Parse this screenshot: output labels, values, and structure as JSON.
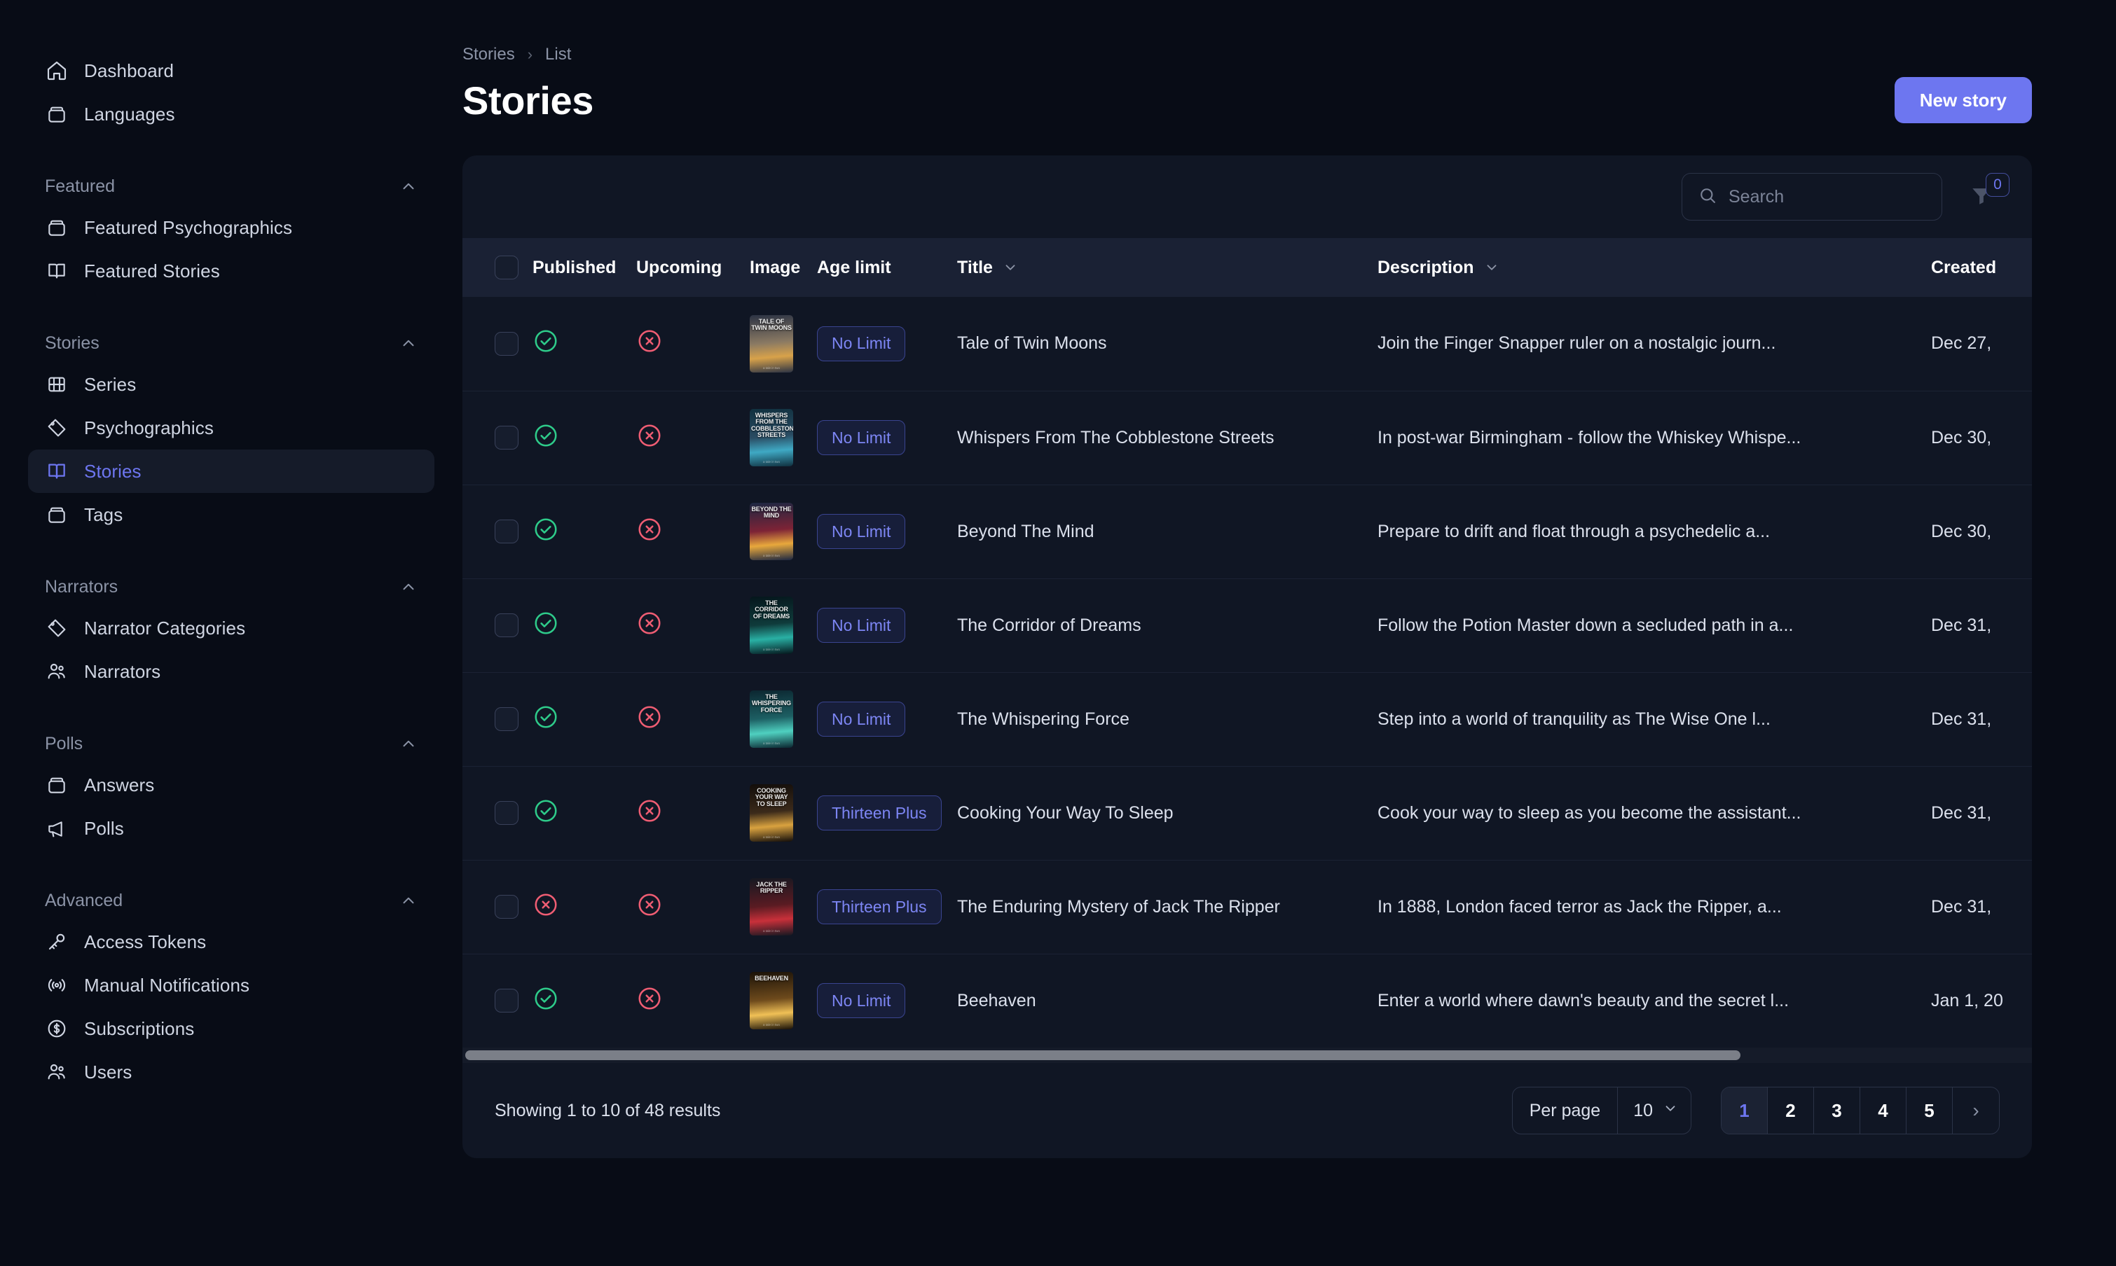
{
  "sidebar": {
    "top_items": [
      {
        "label": "Dashboard",
        "icon": "home-icon"
      },
      {
        "label": "Languages",
        "icon": "box-icon"
      }
    ],
    "groups": [
      {
        "label": "Featured",
        "items": [
          {
            "label": "Featured Psychographics",
            "icon": "box-icon"
          },
          {
            "label": "Featured Stories",
            "icon": "book-icon"
          }
        ]
      },
      {
        "label": "Stories",
        "items": [
          {
            "label": "Series",
            "icon": "film-icon"
          },
          {
            "label": "Psychographics",
            "icon": "tag-icon"
          },
          {
            "label": "Stories",
            "icon": "book-icon",
            "active": true
          },
          {
            "label": "Tags",
            "icon": "box-icon"
          }
        ]
      },
      {
        "label": "Narrators",
        "items": [
          {
            "label": "Narrator Categories",
            "icon": "tag-icon"
          },
          {
            "label": "Narrators",
            "icon": "users-icon"
          }
        ]
      },
      {
        "label": "Polls",
        "items": [
          {
            "label": "Answers",
            "icon": "box-icon"
          },
          {
            "label": "Polls",
            "icon": "megaphone-icon"
          }
        ]
      },
      {
        "label": "Advanced",
        "items": [
          {
            "label": "Access Tokens",
            "icon": "key-icon"
          },
          {
            "label": "Manual Notifications",
            "icon": "broadcast-icon"
          },
          {
            "label": "Subscriptions",
            "icon": "dollar-circle-icon"
          },
          {
            "label": "Users",
            "icon": "users-icon"
          }
        ]
      }
    ]
  },
  "header": {
    "breadcrumb": {
      "parent": "Stories",
      "separator": "›",
      "current": "List"
    },
    "title": "Stories",
    "new_button": "New story"
  },
  "toolbar": {
    "search_placeholder": "Search",
    "search_value": "",
    "filter_count": "0"
  },
  "table": {
    "columns": [
      {
        "key": "checkbox",
        "label": ""
      },
      {
        "key": "published",
        "label": "Published"
      },
      {
        "key": "upcoming",
        "label": "Upcoming"
      },
      {
        "key": "image",
        "label": "Image"
      },
      {
        "key": "age_limit",
        "label": "Age limit"
      },
      {
        "key": "title",
        "label": "Title",
        "sortable": true
      },
      {
        "key": "description",
        "label": "Description",
        "sortable": true
      },
      {
        "key": "created",
        "label": "Created"
      }
    ],
    "rows": [
      {
        "published": "yes",
        "upcoming": "no",
        "thumb_title": "Tale of Twin Moons",
        "thumb_footer": "a tale in two",
        "thumb_c1": "#8b7a63",
        "thumb_c2": "#2c3344",
        "thumb_c3": "#d8a24a",
        "age_limit": "No Limit",
        "title": "Tale of Twin Moons",
        "description": "Join the Finger Snapper ruler on a nostalgic journ...",
        "created": "Dec 27,"
      },
      {
        "published": "yes",
        "upcoming": "no",
        "thumb_title": "Whispers From The Cobblestone Streets",
        "thumb_footer": "a tale in two",
        "thumb_c1": "#2a4c63",
        "thumb_c2": "#10303f",
        "thumb_c3": "#3fa9c4",
        "age_limit": "No Limit",
        "title": "Whispers From The Cobblestone Streets",
        "description": "In post-war Birmingham - follow the Whiskey Whispe...",
        "created": "Dec 30,"
      },
      {
        "published": "yes",
        "upcoming": "no",
        "thumb_title": "Beyond The Mind",
        "thumb_footer": "a tale in two",
        "thumb_c1": "#7d2336",
        "thumb_c2": "#1c2742",
        "thumb_c3": "#e8a83c",
        "age_limit": "No Limit",
        "title": "Beyond The Mind",
        "description": "Prepare to drift and float through a psychedelic a...",
        "created": "Dec 30,"
      },
      {
        "published": "yes",
        "upcoming": "no",
        "thumb_title": "The Corridor of Dreams",
        "thumb_footer": "a tale in two",
        "thumb_c1": "#0f3b3b",
        "thumb_c2": "#05161c",
        "thumb_c3": "#29b0a4",
        "age_limit": "No Limit",
        "title": "The Corridor of Dreams",
        "description": "Follow the Potion Master down a secluded path in a...",
        "created": "Dec 31,"
      },
      {
        "published": "yes",
        "upcoming": "no",
        "thumb_title": "The Whispering Force",
        "thumb_footer": "a tale in two",
        "thumb_c1": "#1d5f63",
        "thumb_c2": "#0b2630",
        "thumb_c3": "#4fd0c0",
        "age_limit": "No Limit",
        "title": "The Whispering Force",
        "description": "Step into a world of tranquility as The Wise One l...",
        "created": "Dec 31,"
      },
      {
        "published": "yes",
        "upcoming": "no",
        "thumb_title": "Cooking Your Way To Sleep",
        "thumb_footer": "a tale in two",
        "thumb_c1": "#3b2a1a",
        "thumb_c2": "#120d0a",
        "thumb_c3": "#d9a23f",
        "age_limit": "Thirteen Plus",
        "title": "Cooking Your Way To Sleep",
        "description": "Cook your way to sleep as you become the assistant...",
        "created": "Dec 31,"
      },
      {
        "published": "no",
        "upcoming": "no",
        "thumb_title": "Jack The Ripper",
        "thumb_footer": "a tale in two",
        "thumb_c1": "#5a1b22",
        "thumb_c2": "#151821",
        "thumb_c3": "#c8303a",
        "age_limit": "Thirteen Plus",
        "title": "The Enduring Mystery of Jack The Ripper",
        "description": "In 1888, London faced terror as Jack the Ripper, a...",
        "created": "Dec 31,"
      },
      {
        "published": "yes",
        "upcoming": "no",
        "thumb_title": "Beehaven",
        "thumb_footer": "a tale in two",
        "thumb_c1": "#6e4a1c",
        "thumb_c2": "#1a1208",
        "thumb_c3": "#f0c056",
        "age_limit": "No Limit",
        "title": "Beehaven",
        "description": "Enter a world where dawn's beauty and the secret l...",
        "created": "Jan 1, 20"
      }
    ]
  },
  "footer": {
    "results_text": "Showing 1 to 10 of 48 results",
    "per_page_label": "Per page",
    "per_page_value": "10",
    "pages": [
      "1",
      "2",
      "3",
      "4",
      "5"
    ],
    "current_page": "1",
    "next_label": "›"
  },
  "colors": {
    "accent": "#6d76f0",
    "success": "#2ecb8a",
    "danger": "#ef5d73",
    "card_bg": "#101624",
    "page_bg": "#080c16"
  }
}
